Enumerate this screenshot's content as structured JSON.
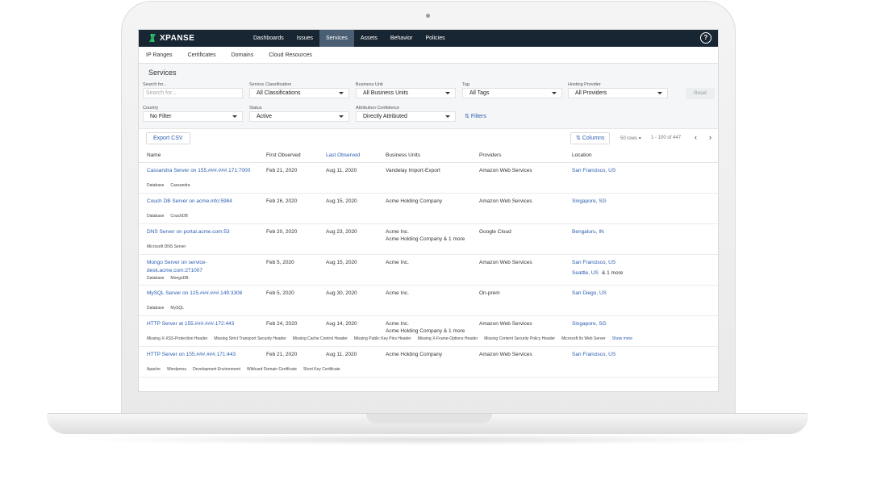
{
  "brand": {
    "name": "XPANSE",
    "accent": "#2ecc71",
    "nav_bg": "#182532"
  },
  "topnav": {
    "items": [
      {
        "label": "Dashboards"
      },
      {
        "label": "Issues"
      },
      {
        "label": "Services",
        "active": true
      },
      {
        "label": "Assets"
      },
      {
        "label": "Behavior"
      },
      {
        "label": "Policies"
      }
    ],
    "help_icon": "?"
  },
  "subnav": {
    "items": [
      "IP Ranges",
      "Certificates",
      "Domains",
      "Cloud Resources"
    ]
  },
  "page": {
    "title": "Services"
  },
  "filters": {
    "search": {
      "label": "Search for...",
      "placeholder": "Search for..."
    },
    "service_classification": {
      "label": "Service Classification",
      "value": "All Classifications"
    },
    "business_unit": {
      "label": "Business Unit",
      "value": "All Business Units"
    },
    "tag": {
      "label": "Tag",
      "value": "All Tags"
    },
    "hosting_provider": {
      "label": "Hosting Provider",
      "value": "All Providers"
    },
    "reset_label": "Reset",
    "country": {
      "label": "Country",
      "value": "No Filter"
    },
    "status": {
      "label": "Status",
      "value": "Active"
    },
    "attribution": {
      "label": "Attribution Confidence",
      "value": "Directly Attributed"
    },
    "filters_link": "Filters"
  },
  "toolbar": {
    "export_label": "Export CSV",
    "columns_label": "Columns",
    "rows_per_page": "50 rows",
    "range": "1 - 100 of 447",
    "prev": "‹",
    "next": "›"
  },
  "table": {
    "headers": [
      "Name",
      "First Observed",
      "Last Observed",
      "Business Units",
      "Providers",
      "Location"
    ],
    "rows": [
      {
        "name": "Cassandra Server on 155.###.###.171:7000",
        "first": "Feb 21, 2020",
        "last": "Aug 11, 2020",
        "bu1": "Vandelay Import-Export",
        "bu2": "",
        "provider": "Amazon Web Services",
        "loc1": "San Francisco, US",
        "loc2": "",
        "tags": [
          "Database",
          "Cassandra"
        ]
      },
      {
        "name": "Couch DB Server on acme.info:5984",
        "first": "Feb 26, 2020",
        "last": "Aug 15, 2020",
        "bu1": "Acme Holding Company",
        "bu2": "",
        "provider": "Amazon Web Services",
        "loc1": "Singapore, SG",
        "loc2": "",
        "tags": [
          "Database",
          "CouchDB"
        ]
      },
      {
        "name": "DNS Server on portal.acme.com:53",
        "first": "Feb 20, 2020",
        "last": "Aug 23, 2020",
        "bu1": "Acme Inc.",
        "bu2": "Acme Holding Company & 1 more",
        "provider": "Google Cloud",
        "loc1": "Bengaluru, IN",
        "loc2": "",
        "tags": [
          "Microsoft DNS Server"
        ]
      },
      {
        "name": "Mongo Server on service-desk.acme.com:271007",
        "first": "Feb 5, 2020",
        "last": "Aug 15, 2020",
        "bu1": "Acme Inc.",
        "bu2": "",
        "provider": "Amazon Web Services",
        "loc1": "San Francisco, US",
        "loc2": "Seattle, US",
        "loc2_more": "& 1 more",
        "tags": [
          "Database",
          "MongoDB"
        ]
      },
      {
        "name": "MySQL Server on 125.###.###.149:3306",
        "first": "Feb 5, 2020",
        "last": "Aug 30, 2020",
        "bu1": "Acme Inc.",
        "bu2": "",
        "provider": "On-prem",
        "loc1": "San Diego, US",
        "loc2": "",
        "tags": [
          "Database",
          "MySQL"
        ]
      },
      {
        "name": "HTTP Server at 155.###.###.172:443",
        "first": "Feb 24, 2020",
        "last": "Aug 14, 2020",
        "bu1": "Acme Inc.",
        "bu2": "Acme Holding Company & 1 more",
        "provider": "Amazon Web Services",
        "loc1": "Singapore, SG",
        "loc2": "",
        "tags": [
          "Missing X-XSS-Protection Header",
          "Missing Strict Transport Security Header",
          "Missing Cache Control Header",
          "Missing Public Key Pins Header",
          "Missing X-Frame-Options Header",
          "Missing Content Security Policy Header",
          "Microsoft IIs Web Server"
        ],
        "show_more": "Show more"
      },
      {
        "name": "HTTP Server on 155.###.###.171:443",
        "first": "Feb 21, 2020",
        "last": "Aug 11, 2020",
        "bu1": "Acme Holding Company",
        "bu2": "",
        "provider": "Amazon Web Services",
        "loc1": "San Francisco, US",
        "loc2": "",
        "tags": [
          "Apache",
          "Wordpress",
          "Development Environment",
          "Wildcard Domain Certificate",
          "Short Key Certificate"
        ]
      }
    ]
  }
}
